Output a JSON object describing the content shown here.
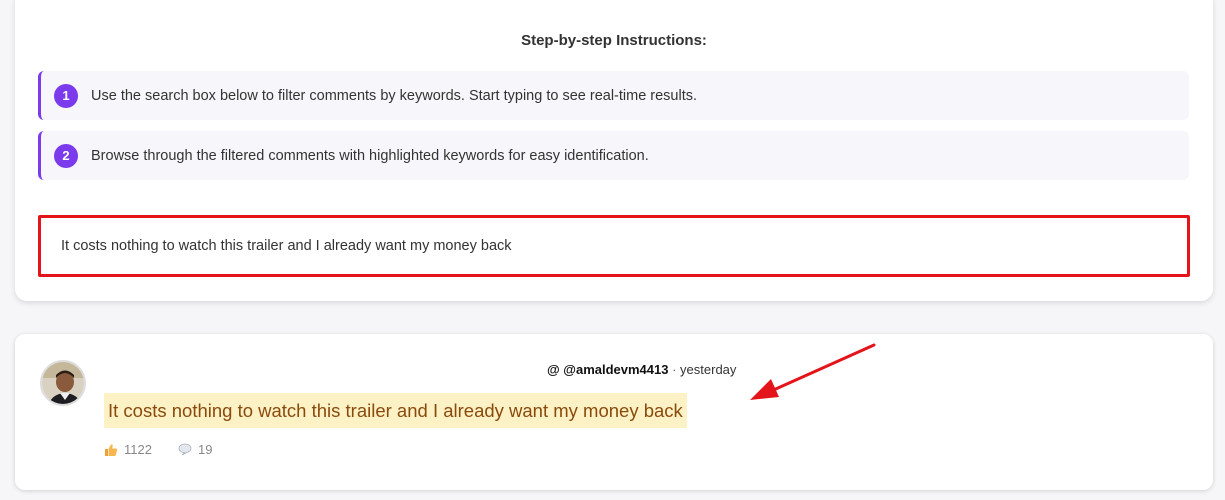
{
  "instructions": {
    "title": "Step-by-step Instructions:",
    "steps": [
      {
        "number": "1",
        "text": "Use the search box below to filter comments by keywords. Start typing to see real-time results."
      },
      {
        "number": "2",
        "text": "Browse through the filtered comments with highlighted keywords for easy identification."
      }
    ]
  },
  "search": {
    "value": "It costs nothing to watch this trailer and I already want my money back"
  },
  "comment": {
    "author": "@ @amaldevm4413",
    "separator": " · ",
    "time": "yesterday",
    "text": "It costs nothing to watch this trailer and I already want my money back",
    "likes": "1122",
    "replies": "19"
  },
  "colors": {
    "accent": "#7c3aed",
    "highlight_box": "#e4141b",
    "match_background": "#fdf2c6",
    "match_text": "#8a4a0c"
  },
  "icons": {
    "likes": "thumbs-up-icon",
    "replies": "speech-bubble-icon",
    "annotation": "red-arrow-icon"
  }
}
